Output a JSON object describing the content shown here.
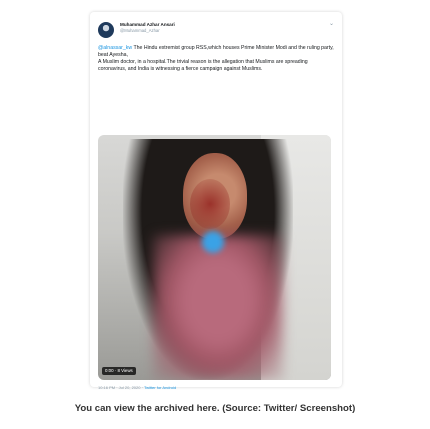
{
  "tweet": {
    "author_name": "Muhammad Azhar Ansari",
    "author_handle": "@Muhammad_Azhar",
    "menu_icon": "chevron-down-icon",
    "text_lines": {
      "l1_link": "@alnassar_kw",
      "l1_rest": " The Hindu extremist group RSS,which houses Prime Minister Modi and the ruling party, beat Ayesha,",
      "l2": "A Muslim doctor, in a hospital.The trivial reason is the allegation that Muslims are spreading coronavirus, and India is witnessing a fierce campaign against Muslims."
    },
    "video_badge": "0:00 · 8 Views",
    "timestamp": "10:16 PM · Jul 20, 2020 · ",
    "source": "Twitter for Android"
  },
  "caption": "You can view the archived here.   (Source: Twitter/ Screenshot)"
}
